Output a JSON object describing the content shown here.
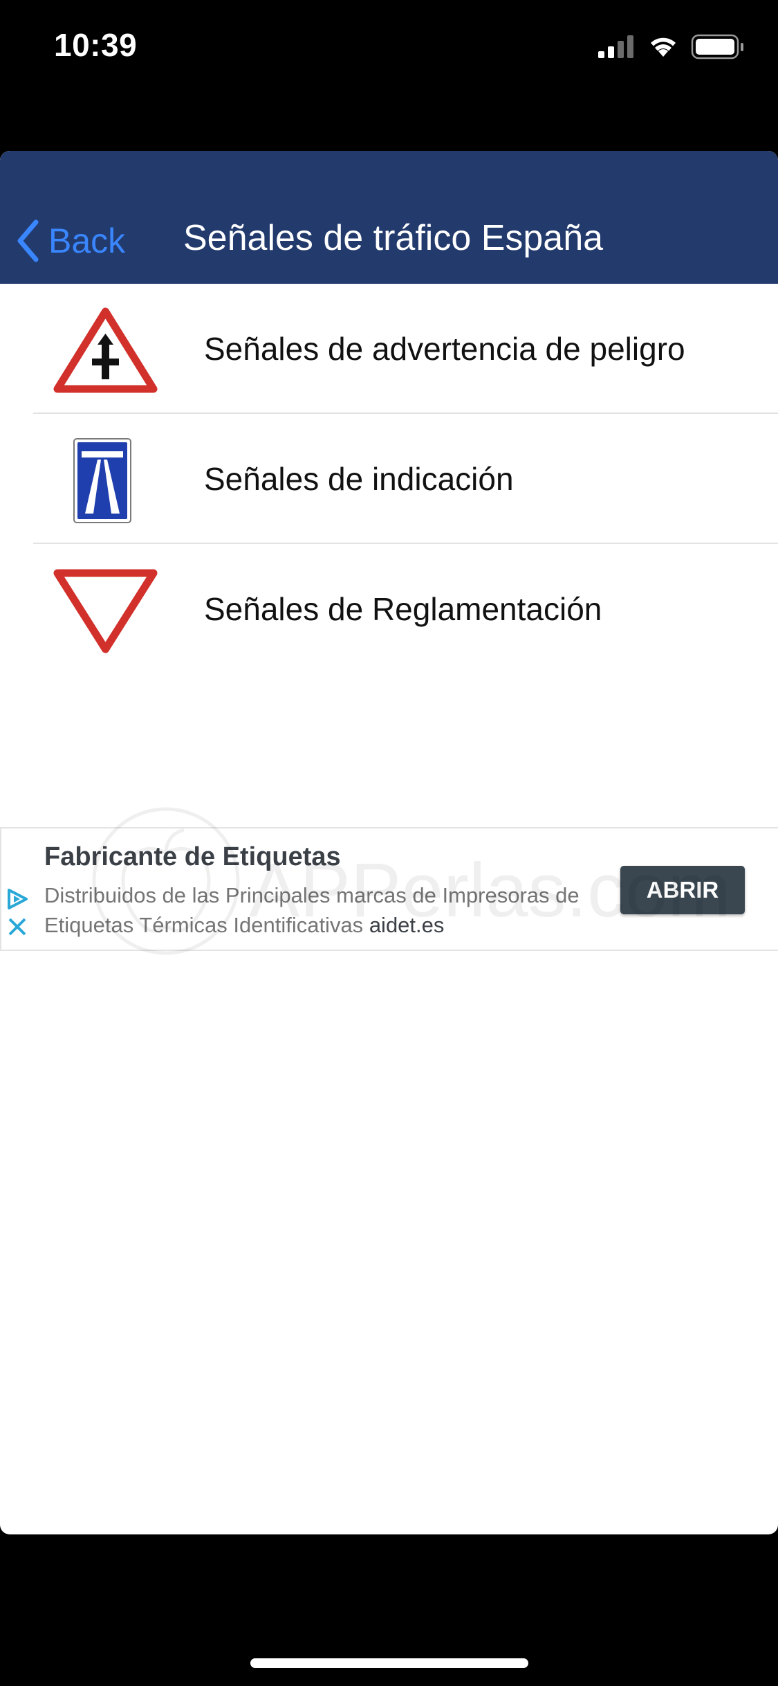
{
  "status_bar": {
    "time": "10:39"
  },
  "nav": {
    "back_label": "Back",
    "title": "Señales de tráfico España",
    "background_color": "#223a6c",
    "accent_color": "#3a86ff"
  },
  "menu": {
    "items": [
      {
        "label": "Señales de advertencia de peligro",
        "icon": "warning-triangle-sign-icon"
      },
      {
        "label": "Señales de indicación",
        "icon": "motorway-sign-icon"
      },
      {
        "label": "Señales de Reglamentación",
        "icon": "yield-sign-icon"
      }
    ]
  },
  "ad": {
    "title": "Fabricante de Etiquetas",
    "description": "Distribuidos de las Principales marcas de Impresoras de Etiquetas Térmicas Identificativas",
    "domain": "aidet.es",
    "cta_label": "ABRIR"
  },
  "watermark": {
    "text": "APPerlas.com"
  }
}
